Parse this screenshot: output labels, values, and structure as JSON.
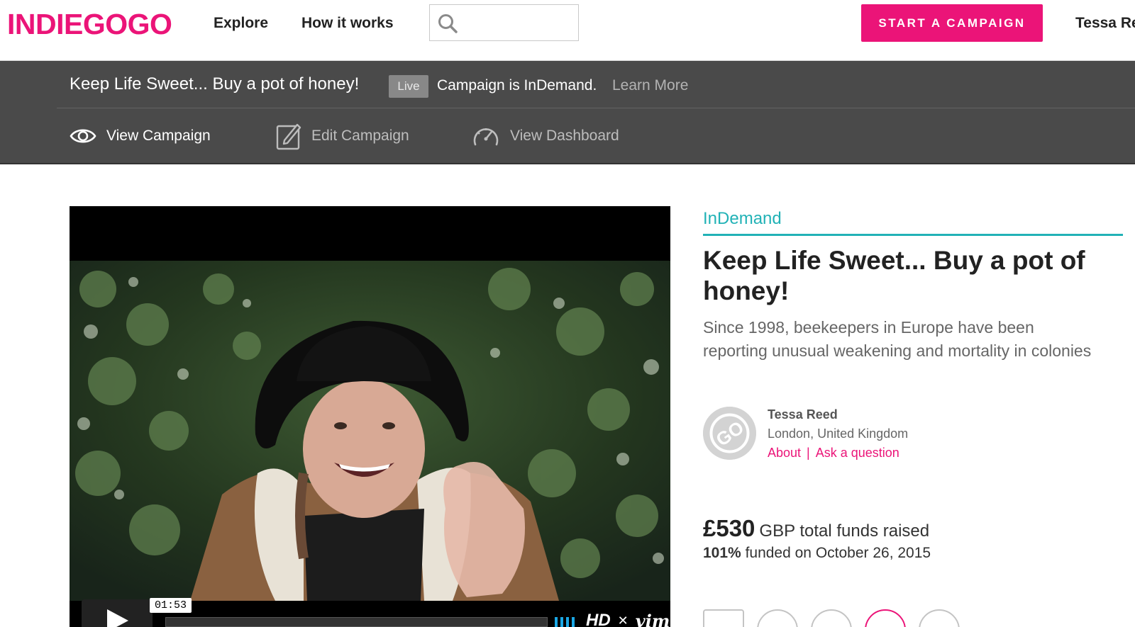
{
  "header": {
    "logo": "INDIEGOGO",
    "nav": [
      "Explore",
      "How it works"
    ],
    "search_placeholder": "",
    "start_campaign": "START A CAMPAIGN",
    "user_name": "Tessa Re"
  },
  "campaign_bar": {
    "title": "Keep Life Sweet... Buy a pot of honey!",
    "badge": "Live",
    "status": "Campaign is InDemand.",
    "learn_more": "Learn More",
    "tabs": [
      "View Campaign",
      "Edit Campaign",
      "View Dashboard"
    ]
  },
  "video": {
    "time": "01:53",
    "hd_label": "HD",
    "brand": "vimeo"
  },
  "campaign": {
    "category_label": "InDemand",
    "title": "Keep Life Sweet... Buy a pot of honey!",
    "description": "Since 1998, beekeepers in Europe have been reporting unusual weakening and mortality in colonies",
    "owner": {
      "avatar_text": "GO",
      "name": "Tessa Reed",
      "location": "London, United Kingdom",
      "about": "About",
      "separator": "|",
      "ask": "Ask a question"
    },
    "funds_amount": "£530",
    "funds_text": "GBP total funds raised",
    "funded_pct": "101%",
    "funded_text": "funded on October 26, 2015"
  },
  "colors": {
    "brand": "#eb1478",
    "indemand": "#21b2b6",
    "campaign_bar": "#4a4a4a"
  },
  "icons": [
    "search-icon",
    "eye-icon",
    "edit-icon",
    "dashboard-icon",
    "play-icon",
    "heart-icon",
    "facebook-icon",
    "twitter-icon",
    "email-icon",
    "link-icon"
  ]
}
